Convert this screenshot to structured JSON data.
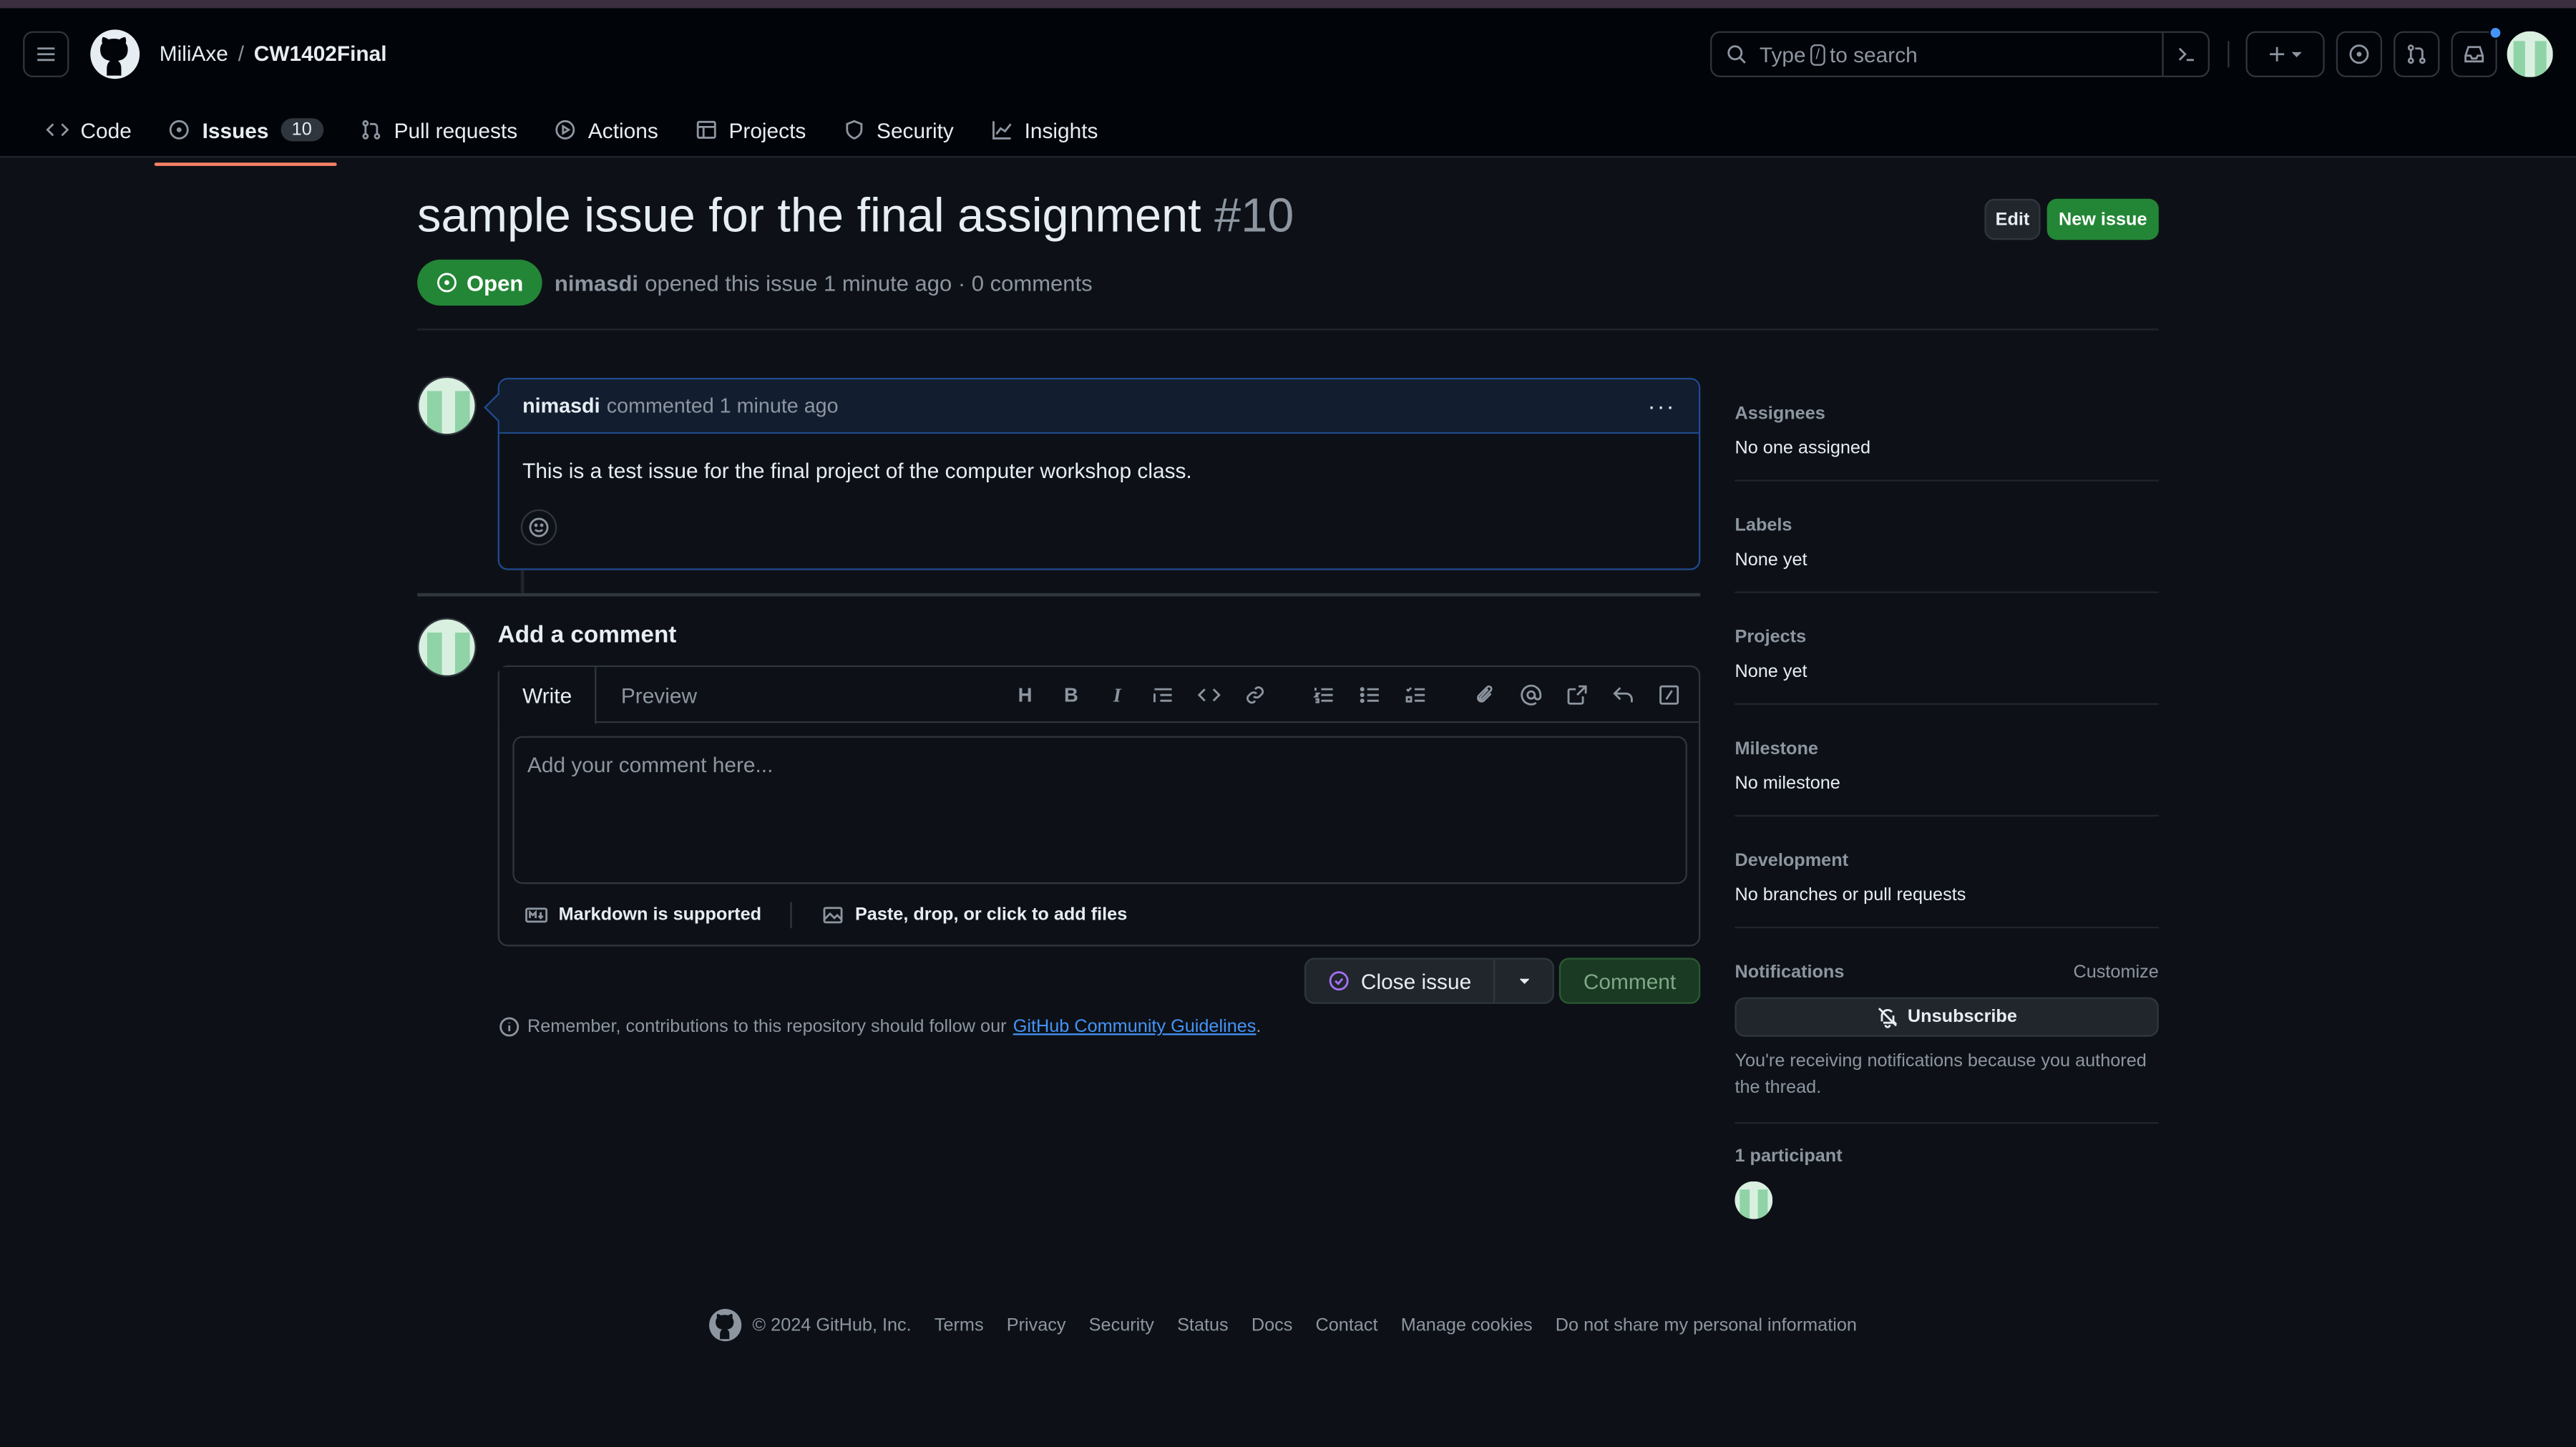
{
  "header": {
    "owner": "MiliAxe",
    "separator": "/",
    "repo": "CW1402Final",
    "search_prefix": "Type",
    "search_key": "/",
    "search_suffix": "to search"
  },
  "repo_nav": {
    "code": "Code",
    "issues": "Issues",
    "issues_count": "10",
    "pull_requests": "Pull requests",
    "actions": "Actions",
    "projects": "Projects",
    "security": "Security",
    "insights": "Insights"
  },
  "issue": {
    "title": "sample issue for the final assignment",
    "number": "#10",
    "edit_label": "Edit",
    "new_issue_label": "New issue",
    "state": "Open",
    "author": "nimasdi",
    "meta_text": "opened this issue 1 minute ago · 0 comments"
  },
  "comment": {
    "author": "nimasdi",
    "action": "commented 1 minute ago",
    "more": "···",
    "body": "This is a test issue for the final project of the computer workshop class."
  },
  "composer": {
    "title": "Add a comment",
    "tab_write": "Write",
    "tab_preview": "Preview",
    "placeholder": "Add your comment here...",
    "markdown_note": "Markdown is supported",
    "files_note": "Paste, drop, or click to add files",
    "close_issue": "Close issue",
    "comment_button": "Comment",
    "remember_text": "Remember, contributions to this repository should follow our",
    "guidelines_link": "GitHub Community Guidelines",
    "period": "."
  },
  "sidebar": {
    "assignees_h": "Assignees",
    "assignees_v": "No one assigned",
    "labels_h": "Labels",
    "labels_v": "None yet",
    "projects_h": "Projects",
    "projects_v": "None yet",
    "milestone_h": "Milestone",
    "milestone_v": "No milestone",
    "development_h": "Development",
    "development_v": "No branches or pull requests",
    "notifications_h": "Notifications",
    "customize": "Customize",
    "unsubscribe": "Unsubscribe",
    "reason": "You're receiving notifications because you authored the thread.",
    "participants": "1 participant"
  },
  "footer": {
    "copyright": "© 2024 GitHub, Inc.",
    "terms": "Terms",
    "privacy": "Privacy",
    "security": "Security",
    "status": "Status",
    "docs": "Docs",
    "contact": "Contact",
    "cookies": "Manage cookies",
    "donotshare": "Do not share my personal information"
  },
  "colors": {
    "accent": "#4493f8",
    "open_green": "#238636",
    "background": "#0d1117"
  }
}
